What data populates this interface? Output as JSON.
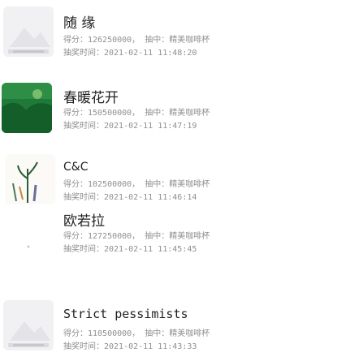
{
  "labels": {
    "score": "得分：",
    "draw": "抽中：",
    "time": "抽奖时间："
  },
  "records": [
    {
      "name": "随 缘",
      "score": "126250000，",
      "prize": "精美咖啡杯",
      "time": "2021-02-11 11:48:20",
      "avatar": "placeholder-logo"
    },
    {
      "name": "春暖花开",
      "score": "150500000，",
      "prize": "精美咖啡杯",
      "time": "2021-02-11 11:47:19",
      "avatar": "green-photo"
    },
    {
      "name": "C&C",
      "score": "102500000，",
      "prize": "精美咖啡杯",
      "time": "2021-02-11 11:46:14",
      "avatar": "plant-drawing"
    },
    {
      "name": "欧若拉",
      "score": "127250000，",
      "prize": "精美咖啡杯",
      "time": "2021-02-11 11:45:45",
      "avatar": "blank"
    },
    {
      "name": "Strict pessimists",
      "score": "110500000，",
      "prize": "精美咖啡杯",
      "time": "2021-02-11 11:43:33",
      "avatar": "placeholder-logo"
    }
  ]
}
